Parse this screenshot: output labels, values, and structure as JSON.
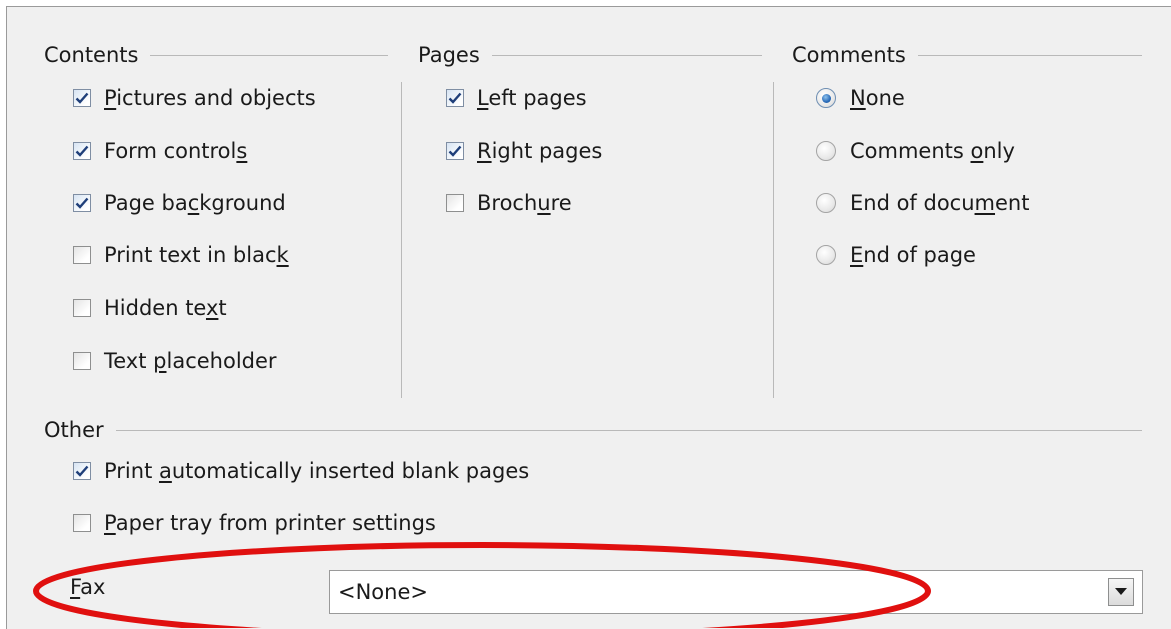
{
  "contents": {
    "title": "Contents",
    "items": [
      {
        "pre": "",
        "u": "P",
        "post": "ictures and objects",
        "checked": true
      },
      {
        "pre": "Form control",
        "u": "s",
        "post": "",
        "checked": true
      },
      {
        "pre": "Page ba",
        "u": "c",
        "post": "kground",
        "checked": true
      },
      {
        "pre": "Print text in blac",
        "u": "k",
        "post": "",
        "checked": false
      },
      {
        "pre": "Hidden te",
        "u": "x",
        "post": "t",
        "checked": false
      },
      {
        "pre": "Text ",
        "u": "p",
        "post": "laceholder",
        "checked": false
      }
    ]
  },
  "pages": {
    "title": "Pages",
    "items": [
      {
        "pre": "",
        "u": "L",
        "post": "eft pages",
        "checked": true
      },
      {
        "pre": "",
        "u": "R",
        "post": "ight pages",
        "checked": true
      },
      {
        "pre": "Broch",
        "u": "u",
        "post": "re",
        "checked": false
      }
    ]
  },
  "comments": {
    "title": "Comments",
    "items": [
      {
        "pre": "",
        "u": "N",
        "post": "one",
        "selected": true
      },
      {
        "pre": "Comments ",
        "u": "o",
        "post": "nly",
        "selected": false
      },
      {
        "pre": "End of docu",
        "u": "m",
        "post": "ent",
        "selected": false
      },
      {
        "pre": "",
        "u": "E",
        "post": "nd of page",
        "selected": false
      }
    ]
  },
  "other": {
    "title": "Other",
    "items": [
      {
        "pre": "Print ",
        "u": "a",
        "post": "utomatically inserted blank pages",
        "checked": true
      },
      {
        "pre": "",
        "u": "P",
        "post": "aper tray from printer settings",
        "checked": false
      }
    ],
    "fax": {
      "pre": "",
      "u": "F",
      "post": "ax",
      "value": "<None>"
    }
  },
  "colors": {
    "highlight_ring": "#e0100f",
    "check_mark": "#1f3f7a",
    "panel_bg": "#f0f0f0"
  }
}
